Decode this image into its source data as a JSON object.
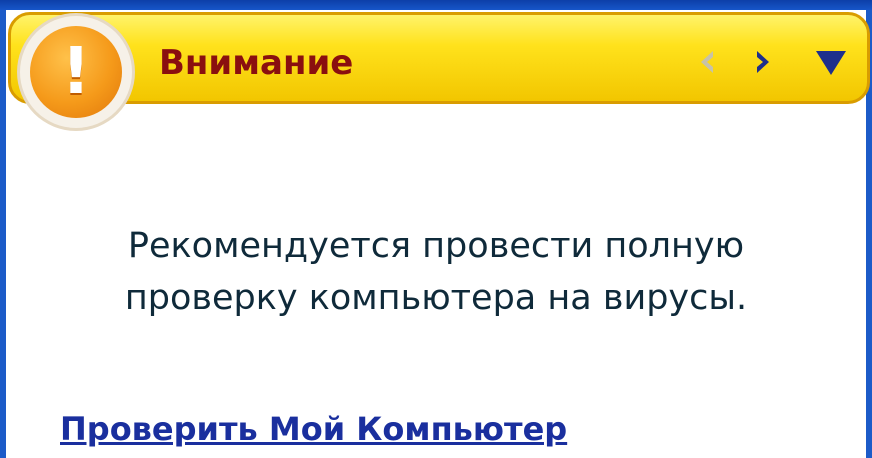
{
  "notification": {
    "title": "Внимание",
    "message_lines": [
      "Рекомендуется провести полную",
      "проверку компьютера на вирусы."
    ],
    "action_link": "Проверить Мой Компьютер",
    "badge_symbol": "!",
    "icons": {
      "badge": "warning-icon",
      "prev": "arrow-left-icon",
      "next": "arrow-right-icon",
      "menu": "triangle-down-icon"
    }
  },
  "colors": {
    "header_yellow": "#ffe21c",
    "title_red": "#8a0f0f",
    "link_blue": "#1a2f9e",
    "frame_blue": "#1c5bc8",
    "badge_orange": "#f59a1a"
  }
}
